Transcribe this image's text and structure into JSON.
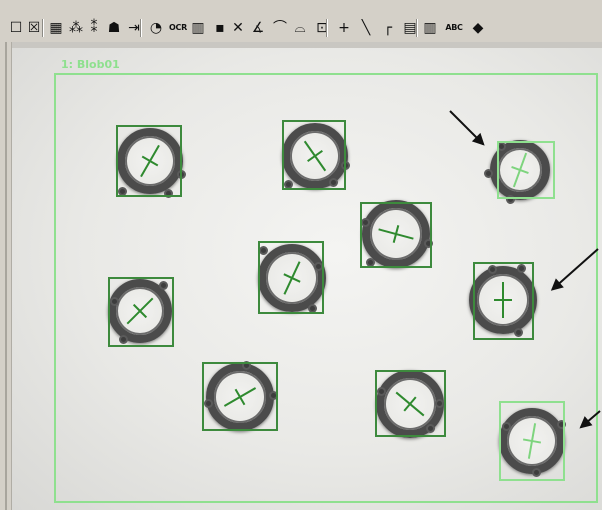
{
  "toolbar": {
    "items": [
      {
        "name": "rectangle-tool",
        "glyph": "☐"
      },
      {
        "name": "delete-region-tool",
        "glyph": "☒"
      },
      {
        "name": "pattern-tool",
        "glyph": "▦"
      },
      {
        "name": "blob-tool",
        "glyph": "⁂"
      },
      {
        "name": "search-tool",
        "glyph": "⁑"
      },
      {
        "name": "shape-tool",
        "glyph": "☗"
      },
      {
        "name": "caliper-tool",
        "glyph": "⇥"
      },
      {
        "name": "dial-tool",
        "glyph": "◔"
      },
      {
        "name": "ocr-tool",
        "glyph": "OCR"
      },
      {
        "name": "barcode-tool",
        "glyph": "▥"
      },
      {
        "name": "color-tool",
        "glyph": "▪"
      },
      {
        "name": "intersection-tool",
        "glyph": "✕"
      },
      {
        "name": "angle-tool",
        "glyph": "∡"
      },
      {
        "name": "circle-fit-tool",
        "glyph": "⌒"
      },
      {
        "name": "arc-tool",
        "glyph": "⌓"
      },
      {
        "name": "spot-tool",
        "glyph": "⊡"
      },
      {
        "name": "point-tool",
        "glyph": "+"
      },
      {
        "name": "line-tool",
        "glyph": "╲"
      },
      {
        "name": "bracket-tool",
        "glyph": "┌"
      },
      {
        "name": "grid-tool",
        "glyph": "▤"
      },
      {
        "name": "verify-tool",
        "glyph": "▥"
      },
      {
        "name": "abc-text-tool",
        "glyph": "ABC"
      },
      {
        "name": "color-match-tool",
        "glyph": "◆"
      }
    ]
  },
  "image": {
    "roi_label": "1: Blob01"
  },
  "colors": {
    "roi": "#8fe08f",
    "bbox": "#3d8a3d",
    "axis": "#2f8a2f",
    "arrow": "#111111"
  }
}
